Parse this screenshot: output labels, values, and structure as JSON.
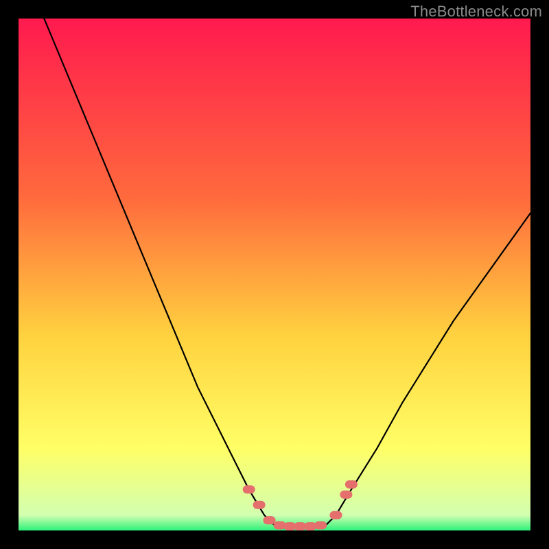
{
  "watermark": "TheBottleneck.com",
  "colors": {
    "frame": "#000000",
    "gradient_top": "#ff1a4e",
    "gradient_mid1": "#ff6a3d",
    "gradient_mid2": "#ffd23f",
    "gradient_mid3": "#ffff66",
    "gradient_bottom": "#2cf27a",
    "curve": "#000000",
    "marker_fill": "#e46f6d",
    "marker_stroke": "#c94f4d"
  },
  "chart_data": {
    "type": "line",
    "title": "",
    "xlabel": "",
    "ylabel": "",
    "xlim": [
      0,
      100
    ],
    "ylim": [
      0,
      100
    ],
    "series": [
      {
        "name": "bottleneck-curve",
        "x": [
          5,
          10,
          15,
          20,
          25,
          30,
          35,
          40,
          42,
          45,
          48,
          50,
          52,
          55,
          58,
          60,
          62,
          65,
          70,
          75,
          80,
          85,
          90,
          95,
          100
        ],
        "y": [
          100,
          88,
          76,
          64,
          52,
          40,
          28,
          18,
          14,
          8,
          3,
          1,
          0.5,
          0.5,
          0.5,
          1,
          3,
          8,
          16,
          25,
          33,
          41,
          48,
          55,
          62
        ]
      }
    ],
    "markers": {
      "name": "highlight-points",
      "x": [
        45,
        47,
        49,
        51,
        53,
        55,
        57,
        59,
        62,
        64,
        65
      ],
      "y": [
        8,
        5,
        2,
        1,
        0.8,
        0.8,
        0.8,
        1,
        3,
        7,
        9
      ]
    }
  }
}
